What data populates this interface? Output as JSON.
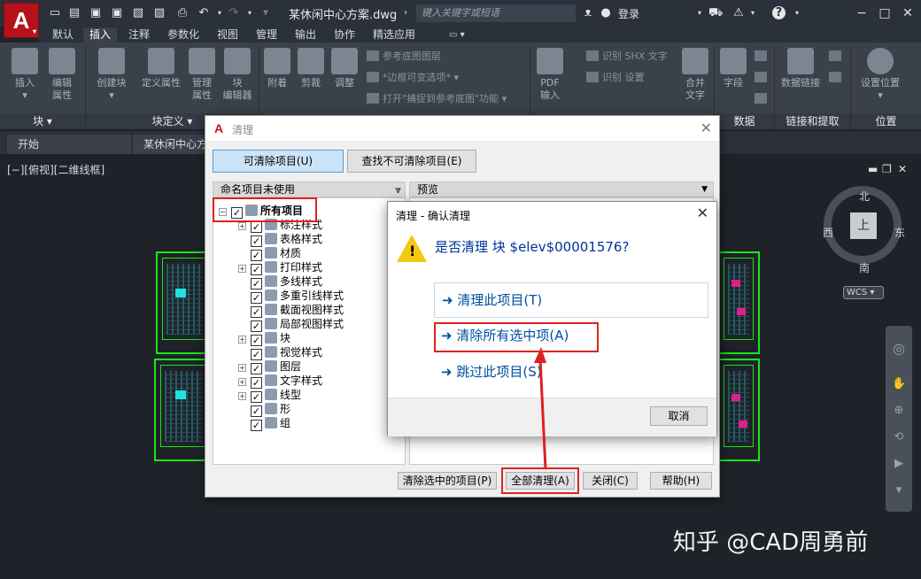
{
  "app": {
    "logo": "A",
    "doc_title": "某休闲中心方案.dwg",
    "search_placeholder": "键入关键字或短语",
    "login": "登录",
    "help": "?"
  },
  "ribbon_tabs": [
    "默认",
    "插入",
    "注释",
    "参数化",
    "视图",
    "管理",
    "输出",
    "协作",
    "精选应用"
  ],
  "ribbon": {
    "block": {
      "insert": "插入",
      "edit_attr": "编辑\n属性",
      "create_block": "创建块",
      "define_attr": "定义属性",
      "manage_attr": "管理\n属性",
      "block_editor": "块\n编辑器"
    },
    "ref": {
      "attach": "附着",
      "clip": "剪裁",
      "adjust": "调整",
      "underlay_layers": "参考底图图层",
      "frames": "*边框可变选项*",
      "snap": "打开\"捕捉到参考底图\"功能"
    },
    "import": {
      "pdf": "PDF\n输入",
      "shx": "识别 SHX 文字",
      "settings": "识别 设置"
    },
    "data": {
      "merge": "合并\n文字",
      "field": "字段"
    },
    "linking": {
      "data_link": "数据链接"
    },
    "location": {
      "set": "设置位置"
    },
    "panels": [
      "块 ▾",
      "块定义 ▾",
      "数据",
      "链接和提取",
      "位置"
    ]
  },
  "doc_tabs": [
    "开始",
    "某休闲中心方"
  ],
  "viewport_label": "[−][俯视][二维线框]",
  "viewcube": {
    "face": "上",
    "north": "北",
    "south": "南",
    "east": "东",
    "west": "西",
    "wcs": "WCS"
  },
  "purge": {
    "title": "清理",
    "tab_purgeable": "可清除项目(U)",
    "tab_nonpurgeable": "查找不可清除项目(E)",
    "col_tree": "命名项目未使用",
    "col_preview": "预览",
    "tree": [
      {
        "label": "所有项目",
        "expand": "⊟",
        "bold": true,
        "indent": 0
      },
      {
        "label": "标注样式",
        "expand": "⊞",
        "indent": 1
      },
      {
        "label": "表格样式",
        "expand": "",
        "indent": 1
      },
      {
        "label": "材质",
        "expand": "",
        "indent": 1
      },
      {
        "label": "打印样式",
        "expand": "⊞",
        "indent": 1
      },
      {
        "label": "多线样式",
        "expand": "",
        "indent": 1
      },
      {
        "label": "多重引线样式",
        "expand": "",
        "indent": 1
      },
      {
        "label": "截面视图样式",
        "expand": "",
        "indent": 1
      },
      {
        "label": "局部视图样式",
        "expand": "",
        "indent": 1
      },
      {
        "label": "块",
        "expand": "⊞",
        "indent": 1
      },
      {
        "label": "视觉样式",
        "expand": "",
        "indent": 1
      },
      {
        "label": "图层",
        "expand": "⊞",
        "indent": 1
      },
      {
        "label": "文字样式",
        "expand": "⊞",
        "indent": 1
      },
      {
        "label": "线型",
        "expand": "⊞",
        "indent": 1
      },
      {
        "label": "形",
        "expand": "",
        "indent": 1
      },
      {
        "label": "组",
        "expand": "",
        "indent": 1
      }
    ],
    "btn_purge_checked": "清除选中的项目(P)",
    "btn_purge_all": "全部清理(A)",
    "btn_close": "关闭(C)",
    "btn_help": "帮助(H)"
  },
  "confirm": {
    "title": "清理 - 确认清理",
    "question": "是否清理 块 $elev$00001576?",
    "opt1": "清理此项目(T)",
    "opt2": "清除所有选中项(A)",
    "opt3": "跳过此项目(S)",
    "cancel": "取消"
  },
  "watermark": "知乎 @CAD周勇前",
  "colors": {
    "accent_red": "#e02020",
    "drawing_green": "#19e619",
    "link_blue": "#0050a0"
  }
}
